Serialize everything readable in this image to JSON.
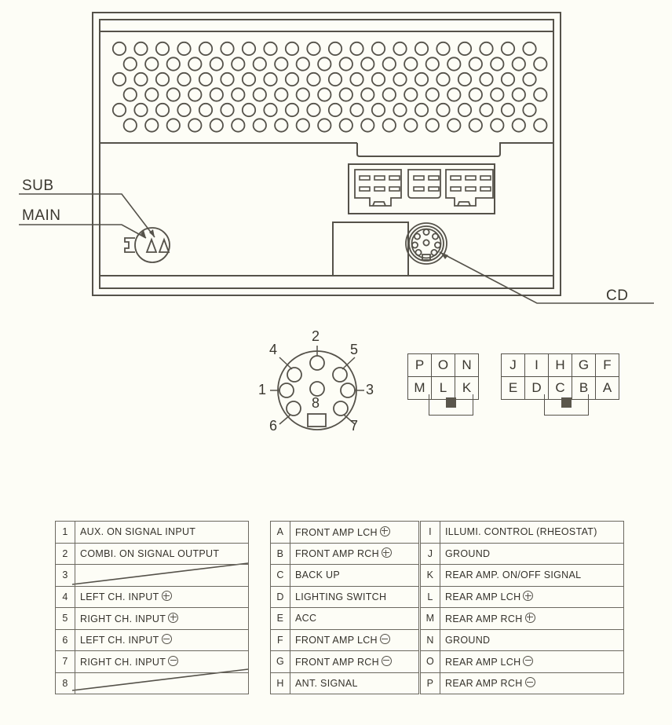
{
  "diagram": {
    "title_labels": {
      "sub": "SUB",
      "main": "MAIN",
      "cd": "CD"
    },
    "din_connector": {
      "name": "8-pin-din-connector",
      "pin_numbers": [
        "1",
        "2",
        "3",
        "4",
        "5",
        "6",
        "7",
        "8"
      ]
    },
    "letter_grid_left": {
      "name": "connector-grid-left",
      "rows": [
        [
          "P",
          "O",
          "N"
        ],
        [
          "M",
          "L",
          "K"
        ]
      ]
    },
    "letter_grid_right": {
      "name": "connector-grid-right",
      "rows": [
        [
          "J",
          "I",
          "H",
          "G",
          "F"
        ],
        [
          "E",
          "D",
          "C",
          "B",
          "A"
        ]
      ]
    }
  },
  "tables": {
    "din_pinout": {
      "name": "din-pinout-table",
      "rows": [
        {
          "key": "1",
          "value": "AUX. ON SIGNAL INPUT",
          "symbol": ""
        },
        {
          "key": "2",
          "value": "COMBI. ON SIGNAL OUTPUT",
          "symbol": ""
        },
        {
          "key": "3",
          "value": "",
          "symbol": ""
        },
        {
          "key": "4",
          "value": "LEFT CH. INPUT",
          "symbol": "plus"
        },
        {
          "key": "5",
          "value": "RIGHT CH. INPUT",
          "symbol": "plus"
        },
        {
          "key": "6",
          "value": "LEFT CH. INPUT",
          "symbol": "minus"
        },
        {
          "key": "7",
          "value": "RIGHT CH. INPUT",
          "symbol": "minus"
        },
        {
          "key": "8",
          "value": "",
          "symbol": ""
        }
      ]
    },
    "harness_a_h": {
      "name": "harness-pinout-table-a-h",
      "rows": [
        {
          "key": "A",
          "value": "FRONT AMP LCH",
          "symbol": "plus"
        },
        {
          "key": "B",
          "value": "FRONT AMP RCH",
          "symbol": "plus"
        },
        {
          "key": "C",
          "value": "BACK UP",
          "symbol": ""
        },
        {
          "key": "D",
          "value": "LIGHTING SWITCH",
          "symbol": ""
        },
        {
          "key": "E",
          "value": "ACC",
          "symbol": ""
        },
        {
          "key": "F",
          "value": "FRONT AMP LCH",
          "symbol": "minus"
        },
        {
          "key": "G",
          "value": "FRONT AMP RCH",
          "symbol": "minus"
        },
        {
          "key": "H",
          "value": "ANT. SIGNAL",
          "symbol": ""
        }
      ]
    },
    "harness_i_p": {
      "name": "harness-pinout-table-i-p",
      "rows": [
        {
          "key": "I",
          "value": "ILLUMI. CONTROL (RHEOSTAT)",
          "symbol": ""
        },
        {
          "key": "J",
          "value": "GROUND",
          "symbol": ""
        },
        {
          "key": "K",
          "value": "REAR AMP. ON/OFF SIGNAL",
          "symbol": ""
        },
        {
          "key": "L",
          "value": "REAR AMP LCH",
          "symbol": "plus"
        },
        {
          "key": "M",
          "value": "REAR AMP RCH",
          "symbol": "plus"
        },
        {
          "key": "N",
          "value": "GROUND",
          "symbol": ""
        },
        {
          "key": "O",
          "value": "REAR AMP LCH",
          "symbol": "minus"
        },
        {
          "key": "P",
          "value": "REAR AMP RCH",
          "symbol": "minus"
        }
      ]
    }
  },
  "colors": {
    "background": "#fdfdf6",
    "line": "#55524a",
    "text": "#3a372f",
    "nub": "#5a564c"
  }
}
